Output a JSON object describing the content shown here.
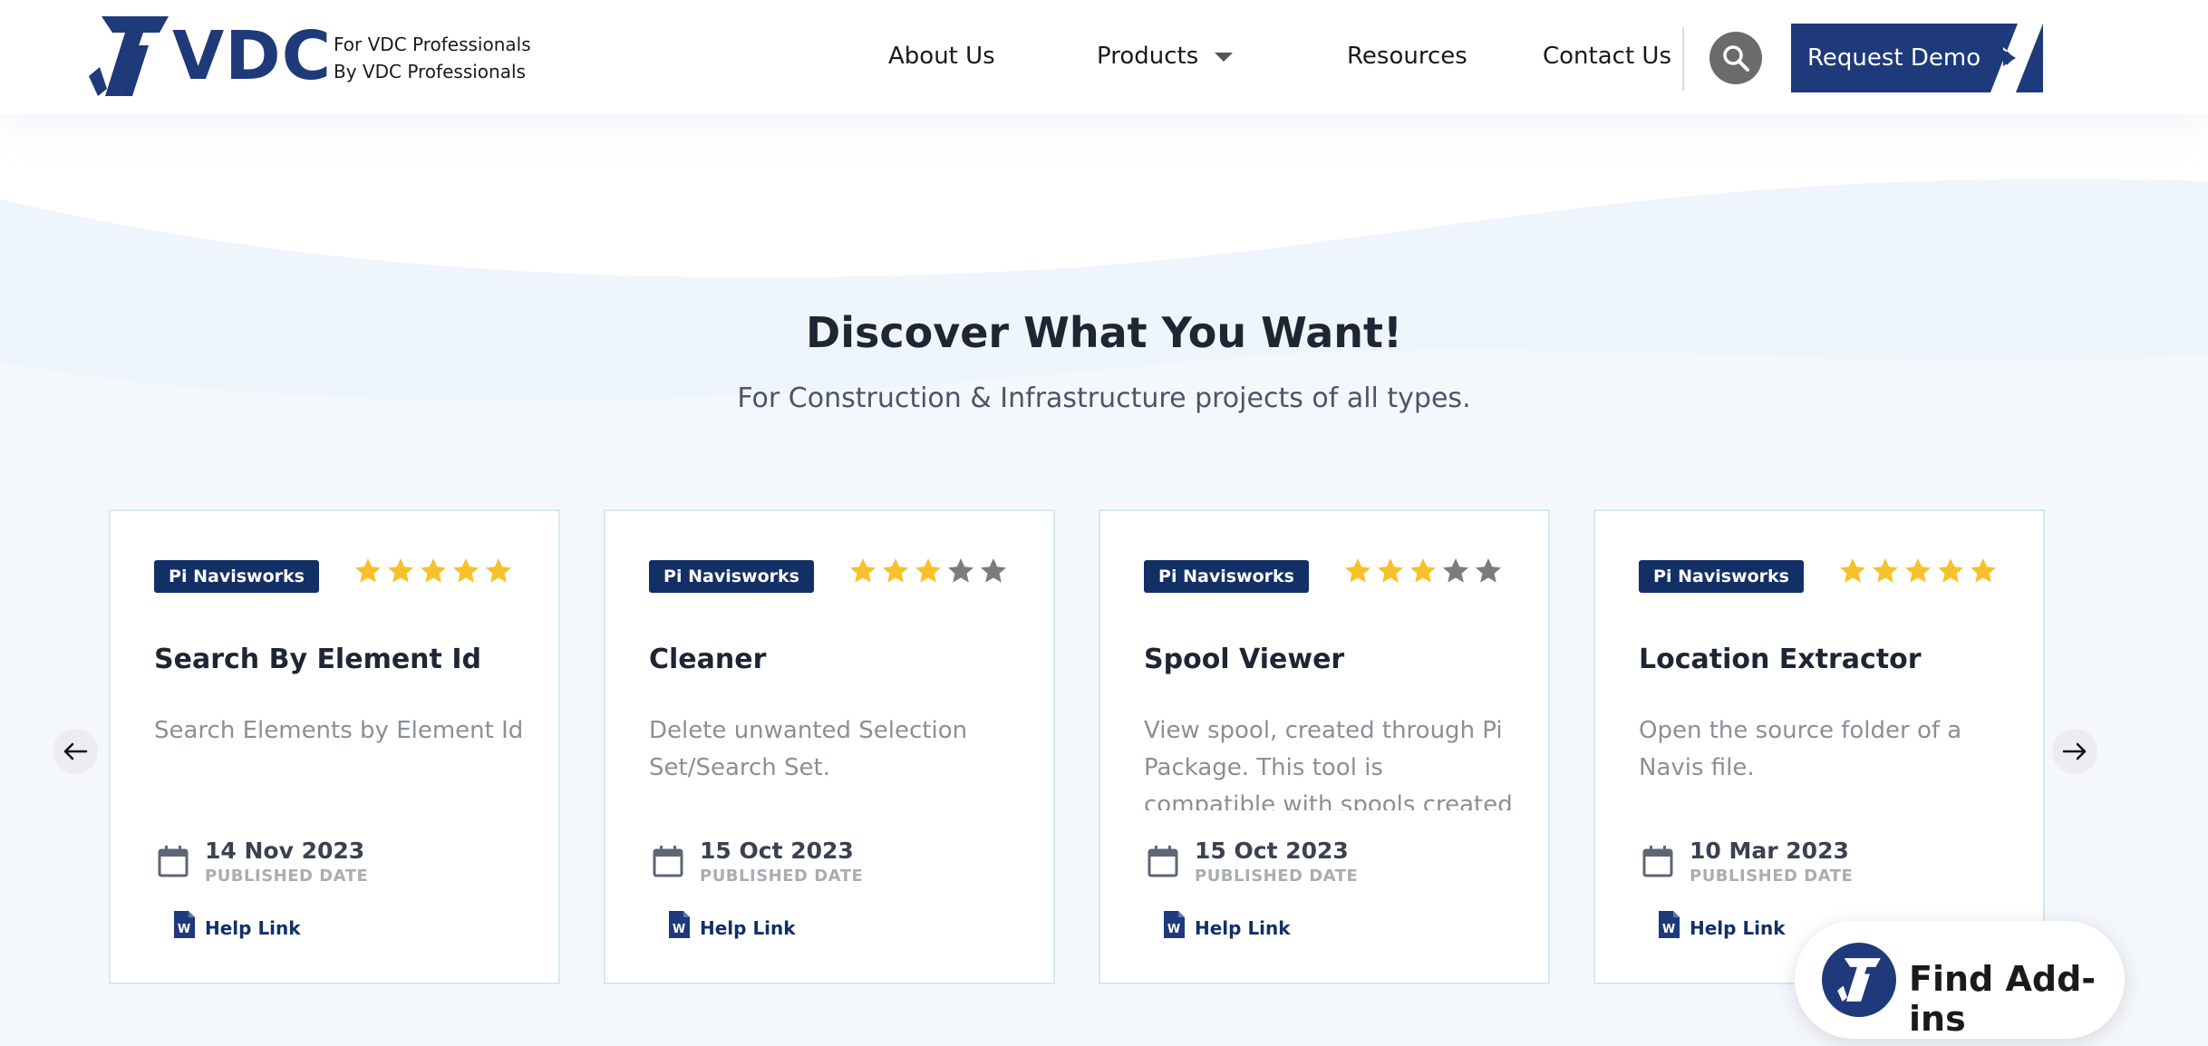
{
  "header": {
    "logo_text": "VDC",
    "tagline_line1": "For VDC Professionals",
    "tagline_line2": "By VDC Professionals",
    "nav": [
      {
        "label": "About Us"
      },
      {
        "label": "Products"
      },
      {
        "label": "Resources"
      },
      {
        "label": "Contact Us"
      }
    ],
    "request_demo_label": "Request Demo",
    "accent_color": "#1f3a7a"
  },
  "hero": {
    "title": "Discover What You Want!",
    "subtitle": "For Construction & Infrastructure projects of all types."
  },
  "cards": [
    {
      "badge": "Pi Navisworks",
      "rating": 5,
      "title": "Search By Element Id",
      "description": "Search Elements by Element Id",
      "date": "14 Nov 2023",
      "date_label": "PUBLISHED DATE",
      "help_link": "Help Link"
    },
    {
      "badge": "Pi Navisworks",
      "rating": 3,
      "title": "Cleaner",
      "description": "Delete unwanted Selection Set/Search Set.",
      "date": "15 Oct 2023",
      "date_label": "PUBLISHED DATE",
      "help_link": "Help Link"
    },
    {
      "badge": "Pi Navisworks",
      "rating": 3,
      "title": "Spool Viewer",
      "description": "View spool, created through Pi Package. This tool is compatible with spools created in Pi",
      "date": "15 Oct 2023",
      "date_label": "PUBLISHED DATE",
      "help_link": "Help Link"
    },
    {
      "badge": "Pi Navisworks",
      "rating": 5,
      "title": "Location Extractor",
      "description": "Open the source folder of a Navis file.",
      "date": "10 Mar 2023",
      "date_label": "PUBLISHED DATE",
      "help_link": "Help Link"
    }
  ],
  "find_addins_label": "Find Add-ins",
  "colors": {
    "badge_bg": "#123066",
    "star_filled": "#f8c12a",
    "star_empty": "#7c7c7c",
    "card_border": "#d4e9f5"
  }
}
